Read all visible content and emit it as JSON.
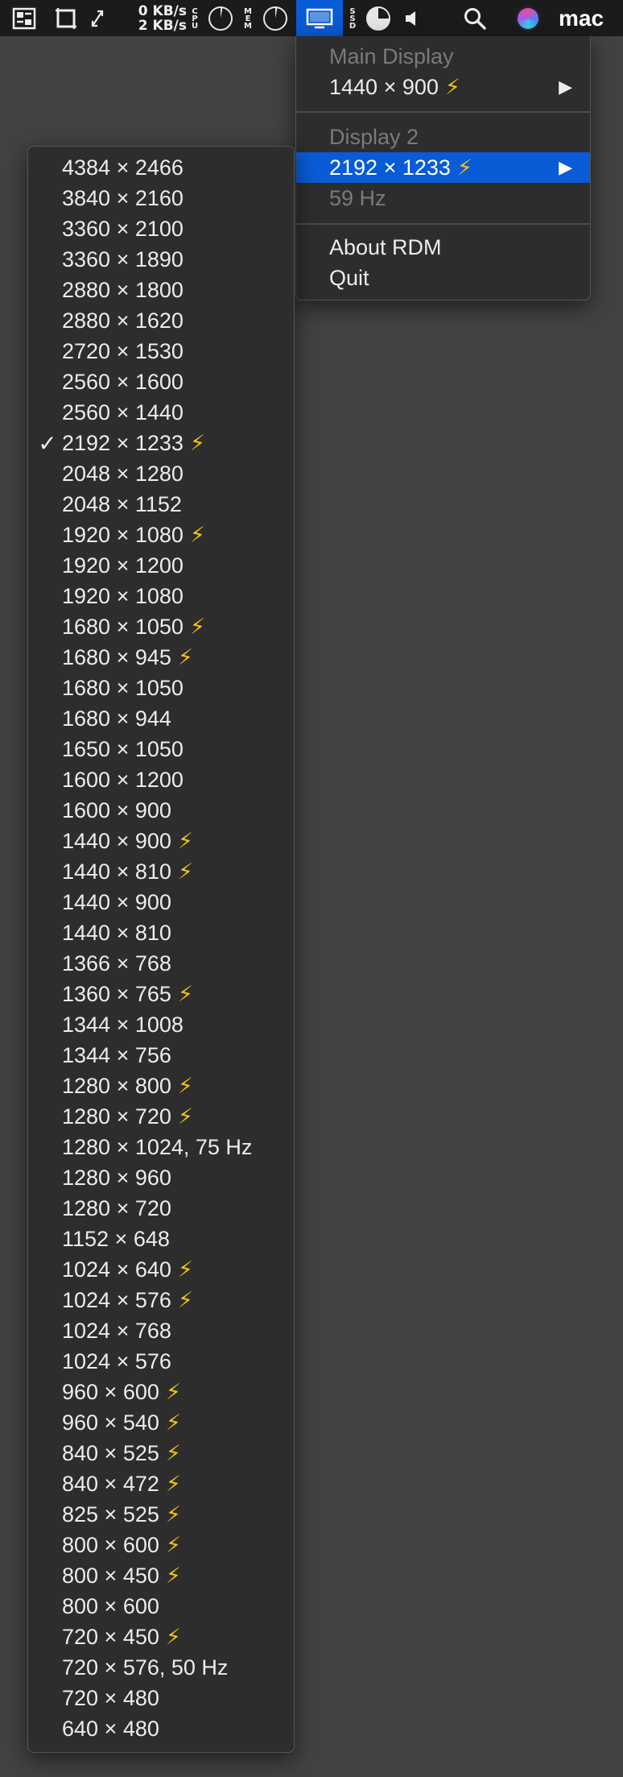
{
  "menubar": {
    "net_up": "0 KB/s",
    "net_down": "2 KB/s",
    "cpu_label": "CPU",
    "mem_label": "MEM",
    "ssd_label": "SSD",
    "user": "mac",
    "icons": [
      "grid-icon",
      "crop-icon",
      "expand-icon",
      "network-stats",
      "cpu-gauge",
      "memory-gauge",
      "display-icon",
      "disk-gauge",
      "speaker-icon",
      "search-icon",
      "siri-icon"
    ]
  },
  "rdm_menu": {
    "main_display_header": "Main Display",
    "main_display_resolution": "1440 × 900",
    "display2_header": "Display 2",
    "display2_resolution": "2192 × 1233",
    "display2_refresh": "59 Hz",
    "about": "About RDM",
    "quit": "Quit",
    "submenu_arrow": "▶"
  },
  "resolutions": [
    {
      "label": "4384 × 2466",
      "hidpi": false,
      "checked": false
    },
    {
      "label": "3840 × 2160",
      "hidpi": false,
      "checked": false
    },
    {
      "label": "3360 × 2100",
      "hidpi": false,
      "checked": false
    },
    {
      "label": "3360 × 1890",
      "hidpi": false,
      "checked": false
    },
    {
      "label": "2880 × 1800",
      "hidpi": false,
      "checked": false
    },
    {
      "label": "2880 × 1620",
      "hidpi": false,
      "checked": false
    },
    {
      "label": "2720 × 1530",
      "hidpi": false,
      "checked": false
    },
    {
      "label": "2560 × 1600",
      "hidpi": false,
      "checked": false
    },
    {
      "label": "2560 × 1440",
      "hidpi": false,
      "checked": false
    },
    {
      "label": "2192 × 1233",
      "hidpi": true,
      "checked": true
    },
    {
      "label": "2048 × 1280",
      "hidpi": false,
      "checked": false
    },
    {
      "label": "2048 × 1152",
      "hidpi": false,
      "checked": false
    },
    {
      "label": "1920 × 1080",
      "hidpi": true,
      "checked": false
    },
    {
      "label": "1920 × 1200",
      "hidpi": false,
      "checked": false
    },
    {
      "label": "1920 × 1080",
      "hidpi": false,
      "checked": false
    },
    {
      "label": "1680 × 1050",
      "hidpi": true,
      "checked": false
    },
    {
      "label": "1680 × 945",
      "hidpi": true,
      "checked": false
    },
    {
      "label": "1680 × 1050",
      "hidpi": false,
      "checked": false
    },
    {
      "label": "1680 × 944",
      "hidpi": false,
      "checked": false
    },
    {
      "label": "1650 × 1050",
      "hidpi": false,
      "checked": false
    },
    {
      "label": "1600 × 1200",
      "hidpi": false,
      "checked": false
    },
    {
      "label": "1600 × 900",
      "hidpi": false,
      "checked": false
    },
    {
      "label": "1440 × 900",
      "hidpi": true,
      "checked": false
    },
    {
      "label": "1440 × 810",
      "hidpi": true,
      "checked": false
    },
    {
      "label": "1440 × 900",
      "hidpi": false,
      "checked": false
    },
    {
      "label": "1440 × 810",
      "hidpi": false,
      "checked": false
    },
    {
      "label": "1366 × 768",
      "hidpi": false,
      "checked": false
    },
    {
      "label": "1360 × 765",
      "hidpi": true,
      "checked": false
    },
    {
      "label": "1344 × 1008",
      "hidpi": false,
      "checked": false
    },
    {
      "label": "1344 × 756",
      "hidpi": false,
      "checked": false
    },
    {
      "label": "1280 × 800",
      "hidpi": true,
      "checked": false
    },
    {
      "label": "1280 × 720",
      "hidpi": true,
      "checked": false
    },
    {
      "label": "1280 × 1024, 75 Hz",
      "hidpi": false,
      "checked": false
    },
    {
      "label": "1280 × 960",
      "hidpi": false,
      "checked": false
    },
    {
      "label": "1280 × 720",
      "hidpi": false,
      "checked": false
    },
    {
      "label": "1152 × 648",
      "hidpi": false,
      "checked": false
    },
    {
      "label": "1024 × 640",
      "hidpi": true,
      "checked": false
    },
    {
      "label": "1024 × 576",
      "hidpi": true,
      "checked": false
    },
    {
      "label": "1024 × 768",
      "hidpi": false,
      "checked": false
    },
    {
      "label": "1024 × 576",
      "hidpi": false,
      "checked": false
    },
    {
      "label": "960 × 600",
      "hidpi": true,
      "checked": false
    },
    {
      "label": "960 × 540",
      "hidpi": true,
      "checked": false
    },
    {
      "label": "840 × 525",
      "hidpi": true,
      "checked": false
    },
    {
      "label": "840 × 472",
      "hidpi": true,
      "checked": false
    },
    {
      "label": "825 × 525",
      "hidpi": true,
      "checked": false
    },
    {
      "label": "800 × 600",
      "hidpi": true,
      "checked": false
    },
    {
      "label": "800 × 450",
      "hidpi": true,
      "checked": false
    },
    {
      "label": "800 × 600",
      "hidpi": false,
      "checked": false
    },
    {
      "label": "720 × 450",
      "hidpi": true,
      "checked": false
    },
    {
      "label": "720 × 576, 50 Hz",
      "hidpi": false,
      "checked": false
    },
    {
      "label": "720 × 480",
      "hidpi": false,
      "checked": false
    },
    {
      "label": "640 × 480",
      "hidpi": false,
      "checked": false
    }
  ],
  "symbols": {
    "hidpi": "⚡",
    "check": "✓"
  },
  "colors": {
    "highlight": "#0a5bd6",
    "bolt": "#f2c318",
    "menu_bg": "#2d2d2d",
    "desktop": "#424242"
  }
}
